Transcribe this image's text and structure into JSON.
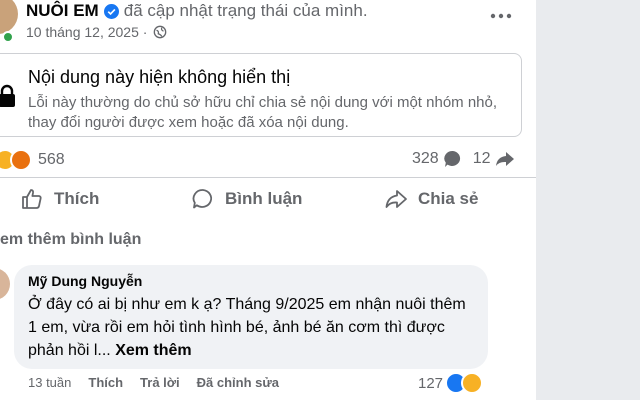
{
  "post": {
    "author": "NUÔI EM",
    "status": "đã cập nhật trạng thái của mình.",
    "date": "10 tháng 12, 2025",
    "privacy_icon": "globe-icon",
    "more_icon": "more-horizontal-icon"
  },
  "unavailable": {
    "title": "Nội dung này hiện không hiển thị",
    "description": "Lỗi này thường do chủ sở hữu chỉ chia sẻ nội dung với một nhóm nhỏ, thay đổi người được xem hoặc đã xóa nội dung."
  },
  "stats": {
    "reactions_count": "568",
    "comments_count": "328",
    "shares_count": "12"
  },
  "actions": {
    "like": "Thích",
    "comment": "Bình luận",
    "share": "Chia sẻ"
  },
  "comments_section": {
    "more_label": "em thêm bình luận"
  },
  "comment": {
    "author": "Mỹ Dung Nguyễn",
    "text": "Ở đây có ai bị như em k ạ? Tháng 9/2025 em nhận nuôi thêm 1 em, vừa rồi em hỏi tình hình bé, ảnh bé ăn cơm thì được phản hồi l...",
    "see_more": "Xem thêm",
    "time": "13 tuần",
    "like": "Thích",
    "reply": "Trả lời",
    "edited": "Đã chỉnh sửa",
    "reactions_count": "127"
  },
  "colors": {
    "accent": "#1877f2",
    "secondary_text": "#65676b",
    "bubble": "#f0f2f5"
  }
}
